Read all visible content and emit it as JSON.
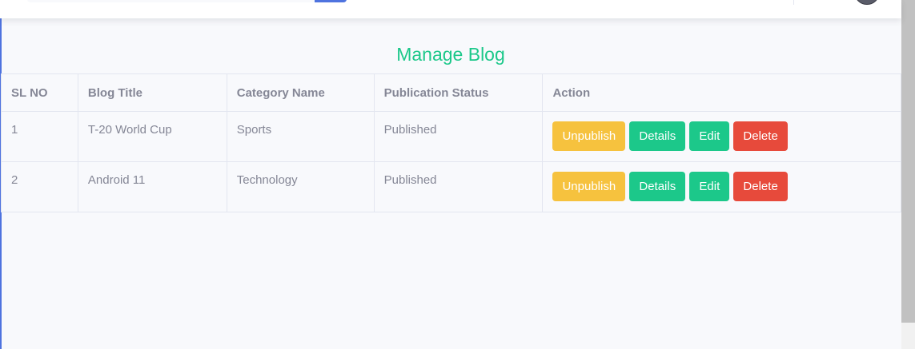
{
  "page": {
    "title": "Manage Blog"
  },
  "colors": {
    "primary": "#4e73df",
    "success": "#1cc88a",
    "warning": "#f6c23e",
    "danger": "#e74a3b",
    "text": "#858796"
  },
  "table": {
    "headers": [
      "SL NO",
      "Blog Title",
      "Category Name",
      "Publication Status",
      "Action"
    ],
    "rows": [
      {
        "sl_no": "1",
        "blog_title": "T-20 World Cup",
        "category": "Sports",
        "status": "Published",
        "actions": {
          "unpublish": "Unpublish",
          "details": "Details",
          "edit": "Edit",
          "delete": "Delete"
        }
      },
      {
        "sl_no": "2",
        "blog_title": "Android 11",
        "category": "Technology",
        "status": "Published",
        "actions": {
          "unpublish": "Unpublish",
          "details": "Details",
          "edit": "Edit",
          "delete": "Delete"
        }
      }
    ]
  }
}
